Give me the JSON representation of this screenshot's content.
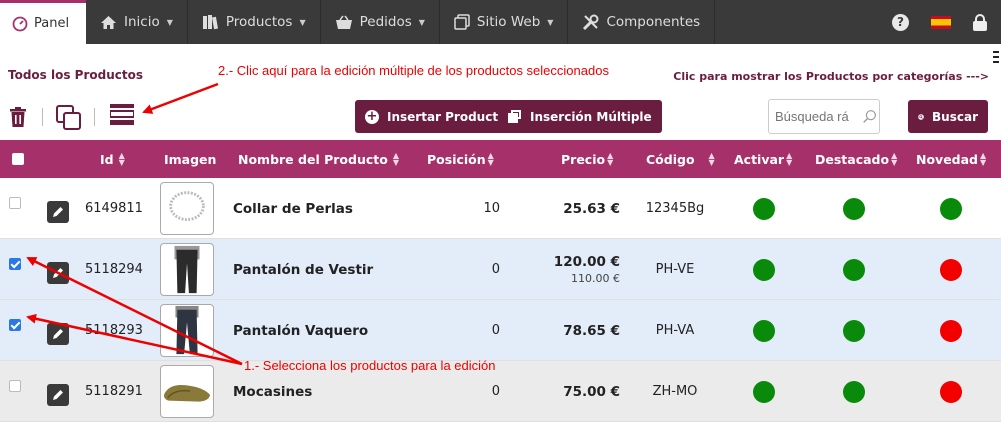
{
  "nav": {
    "panel": "Panel",
    "items": [
      {
        "label": "Inicio",
        "icon": "home-icon",
        "caret": true
      },
      {
        "label": "Productos",
        "icon": "books-icon",
        "caret": true
      },
      {
        "label": "Pedidos",
        "icon": "basket-icon",
        "caret": true
      },
      {
        "label": "Sitio Web",
        "icon": "window-icon",
        "caret": true
      },
      {
        "label": "Componentes",
        "icon": "tools-icon",
        "caret": false
      }
    ],
    "help": "?"
  },
  "page": {
    "title": "Todos los Productos",
    "category_link": "Clic para mostrar los Productos por categorías --->"
  },
  "annotations": {
    "step2": "2.- Clic aquí para la edición múltiple de los productos seleccionados",
    "step1": "1.- Selecciona los productos para la edición",
    "color": "#ee0000"
  },
  "toolbar": {
    "insert_label": "Insertar Producto",
    "multi_label": "Inserción Múltiple",
    "search_placeholder": "Búsqueda rá",
    "search_button": "Buscar"
  },
  "table": {
    "columns": [
      "Id",
      "Imagen",
      "Nombre del Producto",
      "Posición",
      "Precio",
      "Código",
      "Activar",
      "Destacado",
      "Novedad"
    ],
    "rows": [
      {
        "checked": false,
        "id": "6149811",
        "image": "necklace",
        "name": "Collar de Perlas",
        "position": "10",
        "price": "25.63 €",
        "old_price": "",
        "code": "12345Bg",
        "active": "green",
        "featured": "green",
        "new": "green"
      },
      {
        "checked": true,
        "id": "5118294",
        "image": "dress-trousers",
        "name": "Pantalón de Vestir",
        "position": "0",
        "price": "120.00 €",
        "old_price": "110.00 €",
        "code": "PH-VE",
        "active": "green",
        "featured": "green",
        "new": "red"
      },
      {
        "checked": true,
        "id": "5118293",
        "image": "jeans",
        "name": "Pantalón Vaquero",
        "position": "0",
        "price": "78.65 €",
        "old_price": "",
        "code": "PH-VA",
        "active": "green",
        "featured": "green",
        "new": "red"
      },
      {
        "checked": false,
        "id": "5118291",
        "image": "loafers",
        "name": "Mocasines",
        "position": "0",
        "price": "75.00 €",
        "old_price": "",
        "code": "ZH-MO",
        "active": "green",
        "featured": "green",
        "new": "red"
      }
    ]
  },
  "colors": {
    "brand": "#6b1d3f",
    "header": "#a6306a",
    "nav": "#3a3a3a",
    "selected_row": "#e3ecf9",
    "alt_row": "#ebebeb"
  }
}
